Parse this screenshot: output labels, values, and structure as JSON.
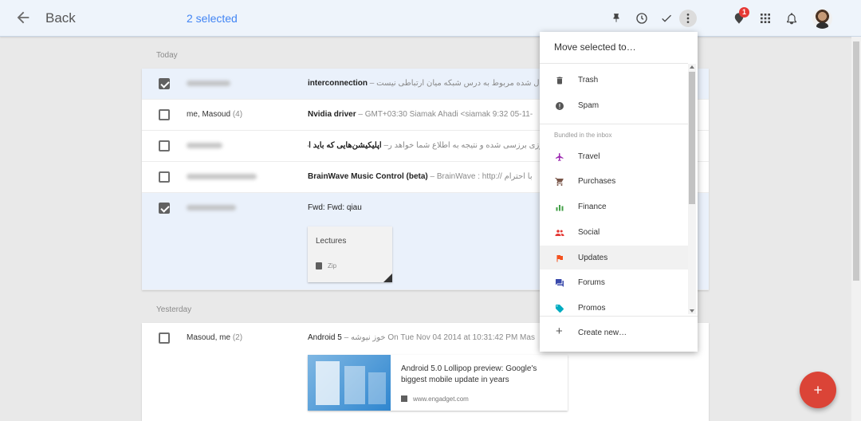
{
  "toolbar": {
    "back_label": "Back",
    "selected_label": "2 selected",
    "notification_count": "1",
    "icons": [
      "back-arrow-icon",
      "pin-icon",
      "snooze-clock-icon",
      "done-check-icon",
      "more-vert-icon",
      "reminders-icon",
      "apps-grid-icon",
      "notifications-bell-icon"
    ]
  },
  "sections": {
    "today": "Today",
    "yesterday": "Yesterday"
  },
  "rows": [
    {
      "sender": "",
      "sender_blurred": true,
      "selected": true,
      "subject": "interconnection",
      "separator": " – ",
      "snippet": "شاهی ارسال شده مربوط به درس شبکه میان ارتباطی نیست."
    },
    {
      "sender": "me, Masoud",
      "count": "(4)",
      "selected": false,
      "subject": "Nvidia driver",
      "separator": " – ",
      "snippet": "GMT+03:30 Siamak Ahadi <siamak 9:32 05-11-"
    },
    {
      "sender": "",
      "sender_blurred": true,
      "selected": false,
      "subject": "",
      "separator": "",
      "snippet": "روزی برزسی شده و نتیجه به اطلاع شما خواهد ر–",
      "snippet_bold": "اپلیکیشن‌هایی که باید اضافه شوند"
    },
    {
      "sender": "",
      "sender_blurred": true,
      "selected": false,
      "subject": "BrainWave Music Control (beta)",
      "separator": " – ",
      "snippet": "BrainWave : http:// با احترام"
    },
    {
      "sender": "",
      "sender_blurred": true,
      "selected": true,
      "subject": "Fwd: Fwd: qiau",
      "separator": "",
      "snippet": "",
      "attachment": {
        "title": "Lectures",
        "type": "Zip"
      }
    }
  ],
  "yesterday_rows": [
    {
      "sender": "Masoud, me",
      "count": "(2)",
      "selected": false,
      "subject": "Android 5",
      "separator": " – ",
      "snippet": "خوز نیوشه On Tue Nov 04 2014 at 10:31:42 PM Mas",
      "link_preview": {
        "title": "Android 5.0 Lollipop preview: Google's biggest mobile update in years",
        "domain": "www.engadget.com"
      }
    }
  ],
  "menu": {
    "title": "Move selected to…",
    "top_items": [
      {
        "label": "Trash",
        "icon": "trash-icon"
      },
      {
        "label": "Spam",
        "icon": "spam-icon"
      }
    ],
    "subheading": "Bundled in the inbox",
    "bundle_items": [
      {
        "label": "Travel",
        "icon": "travel-plane-icon",
        "color": "#9c27b0"
      },
      {
        "label": "Purchases",
        "icon": "purchases-cart-icon",
        "color": "#795548"
      },
      {
        "label": "Finance",
        "icon": "finance-chart-icon",
        "color": "#43a047"
      },
      {
        "label": "Social",
        "icon": "social-people-icon",
        "color": "#e53935"
      },
      {
        "label": "Updates",
        "icon": "updates-flag-icon",
        "color": "#f4511e",
        "hover": true
      },
      {
        "label": "Forums",
        "icon": "forums-chat-icon",
        "color": "#3949ab"
      },
      {
        "label": "Promos",
        "icon": "promos-tag-icon",
        "color": "#00acc1"
      }
    ],
    "create_new": "Create new…"
  },
  "fab": {
    "icon": "plus-icon",
    "color": "#db4437"
  },
  "colors": {
    "accent": "#4285f4",
    "selected_row": "#eaf1fb",
    "topbar": "#eef4fb"
  }
}
